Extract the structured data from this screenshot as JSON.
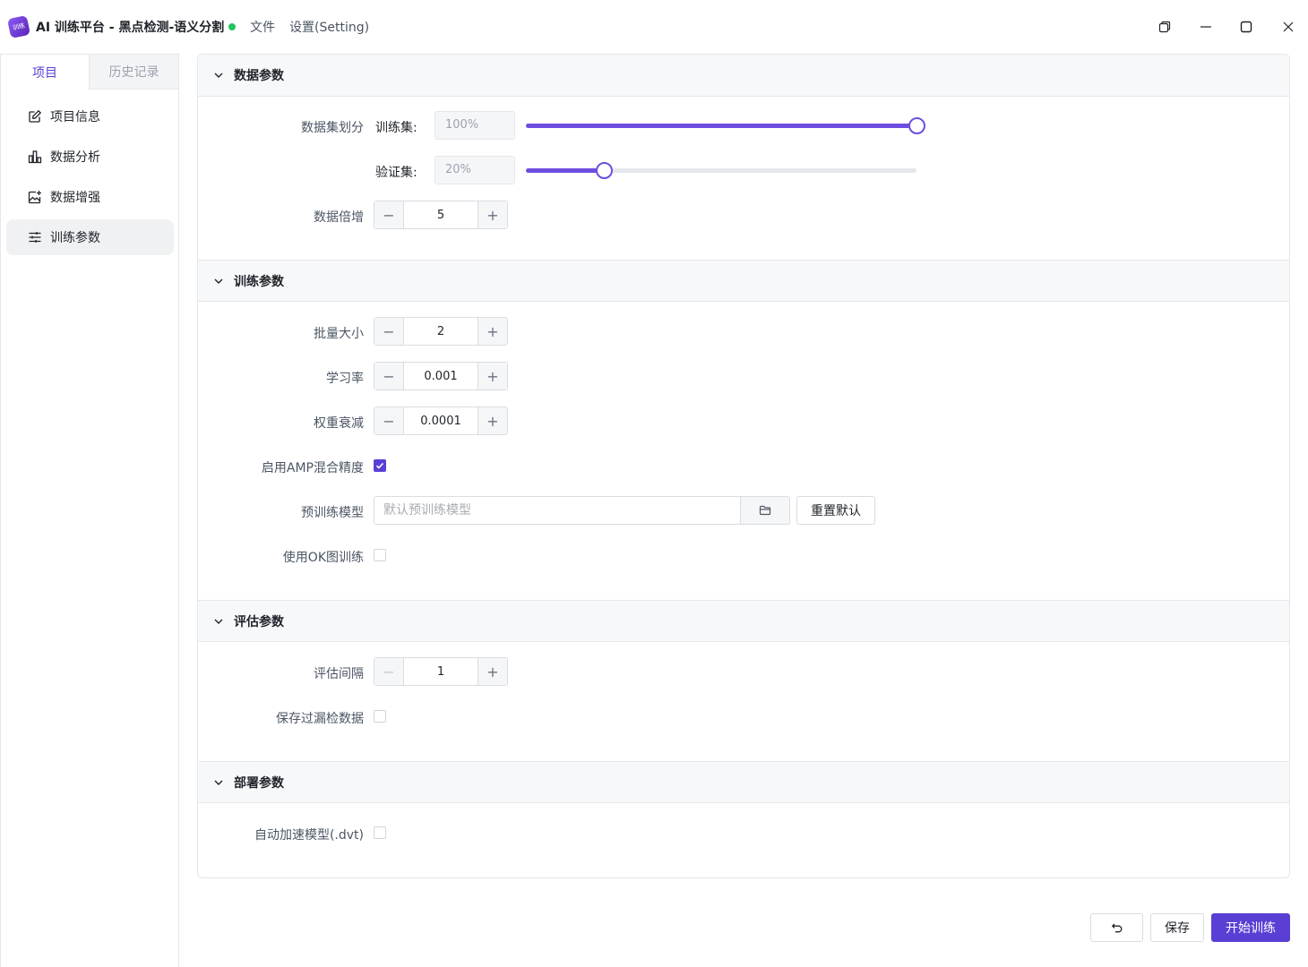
{
  "app": {
    "logo_text": "训练",
    "title": "AI 训练平台 - 黑点检测-语义分割",
    "menu": [
      "文件",
      "设置(Setting)"
    ],
    "status_color": "#22c55e"
  },
  "sidebar": {
    "tabs": [
      "项目",
      "历史记录"
    ],
    "items": [
      {
        "label": "项目信息",
        "icon": "edit-icon"
      },
      {
        "label": "数据分析",
        "icon": "bar-chart-icon"
      },
      {
        "label": "数据增强",
        "icon": "image-plus-icon"
      },
      {
        "label": "训练参数",
        "icon": "sliders-icon"
      }
    ]
  },
  "sections": {
    "data": {
      "title": "数据参数",
      "split_label": "数据集划分",
      "train_label": "训练集:",
      "train_value": "100%",
      "train_pct": 100,
      "val_label": "验证集:",
      "val_value": "20%",
      "val_pct": 20,
      "multiply_label": "数据倍增",
      "multiply_value": "5"
    },
    "train": {
      "title": "训练参数",
      "batch_label": "批量大小",
      "batch_value": "2",
      "lr_label": "学习率",
      "lr_value": "0.001",
      "wd_label": "权重衰减",
      "wd_value": "0.0001",
      "amp_label": "启用AMP混合精度",
      "amp_checked": true,
      "pretrain_label": "预训练模型",
      "pretrain_placeholder": "默认预训练模型",
      "reset_label": "重置默认",
      "ok_label": "使用OK图训练",
      "ok_checked": false
    },
    "eval": {
      "title": "评估参数",
      "interval_label": "评估间隔",
      "interval_value": "1",
      "save_miss_label": "保存过漏检数据",
      "save_miss_checked": false
    },
    "deploy": {
      "title": "部署参数",
      "accel_label": "自动加速模型(.dvt)",
      "accel_checked": false
    }
  },
  "footer": {
    "save_label": "保存",
    "start_label": "开始训练"
  },
  "colors": {
    "accent": "#5b3fd4",
    "slider": "#6d4ee0"
  }
}
